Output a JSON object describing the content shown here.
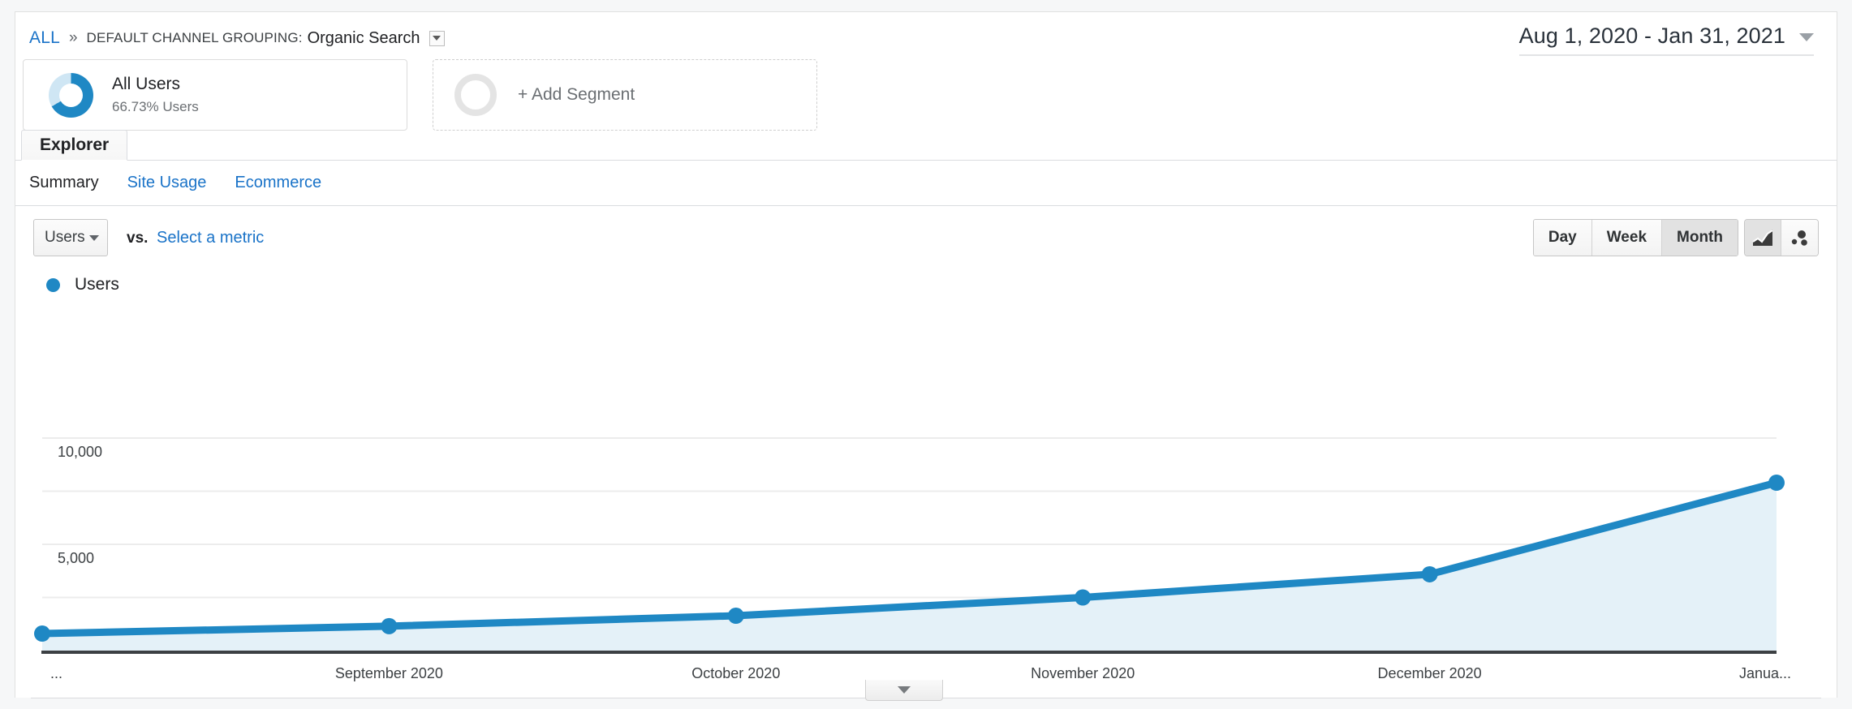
{
  "breadcrumb": {
    "all_label": "ALL",
    "separator": "»",
    "dimension_label": "DEFAULT CHANNEL GROUPING:",
    "dimension_value": "Organic Search",
    "caret_icon": "chevron-down-icon"
  },
  "date_range": {
    "value": "Aug 1, 2020 - Jan 31, 2021",
    "caret_icon": "chevron-down-icon"
  },
  "segments": {
    "active": {
      "name": "All Users",
      "subtitle": "66.73% Users",
      "percent": 66.73,
      "donut_color": "#1f88c4",
      "donut_track_color": "#cfe6f4"
    },
    "add": {
      "label": "+ Add Segment"
    }
  },
  "tabs": {
    "primary": [
      {
        "label": "Explorer",
        "active": true
      }
    ],
    "secondary": [
      {
        "label": "Summary",
        "active": true
      },
      {
        "label": "Site Usage",
        "active": false
      },
      {
        "label": "Ecommerce",
        "active": false
      }
    ]
  },
  "controls": {
    "metric_select": {
      "value": "Users",
      "caret_icon": "chevron-down-icon"
    },
    "vs_label": "vs.",
    "select_metric_link": "Select a metric",
    "granularity": [
      {
        "label": "Day",
        "active": false
      },
      {
        "label": "Week",
        "active": false
      },
      {
        "label": "Month",
        "active": true
      }
    ],
    "chart_types": [
      {
        "icon": "line-chart-icon",
        "active": true
      },
      {
        "icon": "motion-chart-icon",
        "active": false
      }
    ]
  },
  "legend": {
    "series_label": "Users",
    "color": "#1f88c4"
  },
  "bottom": {
    "collapse_icon": "chevron-down-icon"
  },
  "chart_data": {
    "type": "line",
    "title": "",
    "xlabel": "",
    "ylabel": "",
    "series": [
      {
        "name": "Users",
        "color": "#1f88c4",
        "fill_color": "#e4f1f8",
        "values": [
          800,
          1150,
          1640,
          2500,
          3590,
          7900
        ]
      }
    ],
    "categories": [
      "...",
      "September 2020",
      "October 2020",
      "November 2020",
      "December 2020",
      "Janua..."
    ],
    "x_tick_labels": [
      "...",
      "September 2020",
      "October 2020",
      "November 2020",
      "December 2020",
      "Janua..."
    ],
    "y_tick_labels": [
      "10,000",
      "5,000"
    ],
    "y_tick_values": [
      10000,
      5000
    ],
    "gridline_values": [
      10000,
      7500,
      5000,
      2500
    ],
    "ylim": [
      0,
      10000
    ],
    "grid": true,
    "legend_position": "top-left"
  }
}
